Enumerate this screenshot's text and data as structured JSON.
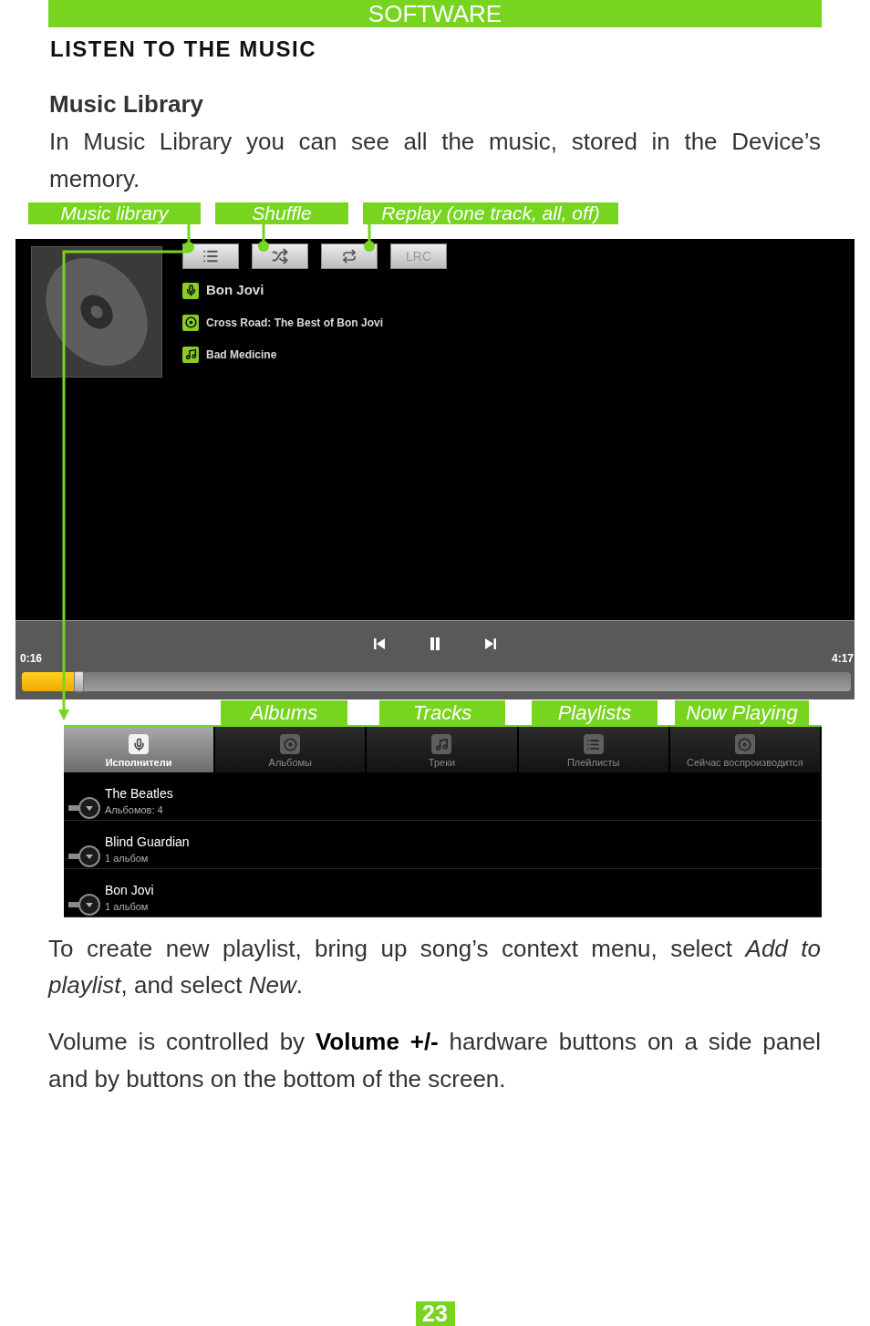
{
  "header": {
    "section": "SOFTWARE",
    "title": "LISTEN TO THE MUSIC"
  },
  "intro": {
    "heading": "Music Library",
    "text": "In Music Library you can see all the music, stored in the Device’s memory."
  },
  "figure": {
    "top_callouts": [
      "Music library",
      "Shuffle",
      "Replay (one track, all, off)"
    ],
    "player": {
      "lrc_button": "LRC",
      "track_info": [
        {
          "kind": "artist",
          "text": "Bon Jovi"
        },
        {
          "kind": "album",
          "text": "Cross Road: The Best of Bon Jovi"
        },
        {
          "kind": "track",
          "text": "Bad Medicine"
        }
      ],
      "elapsed": "0:16",
      "duration": "4:17",
      "progress": {
        "level": 0.067
      }
    },
    "bottom_callouts": [
      "Albums",
      "Tracks",
      "Playlists",
      "Now Playing"
    ],
    "tabs": [
      {
        "kind": "artists",
        "label": "Исполнители",
        "selected": true
      },
      {
        "kind": "albums",
        "label": "Альбомы",
        "selected": false
      },
      {
        "kind": "tracks",
        "label": "Треки",
        "selected": false
      },
      {
        "kind": "playlists",
        "label": "Плейлисты",
        "selected": false
      },
      {
        "kind": "playing",
        "label": "Сейчас воспроизводится",
        "selected": false
      }
    ],
    "artists": [
      {
        "name": "The Beatles",
        "detail": "Альбомов: 4"
      },
      {
        "name": "Blind Guardian",
        "detail": "1 альбом"
      },
      {
        "name": "Bon Jovi",
        "detail": "1 альбом"
      }
    ]
  },
  "paragraphs": [
    "To create new playlist, bring up song’s context menu, select *Add to playlist*, and select *New*.",
    "Volume is controlled by **Volume +/-** hardware buttons on a side panel and by buttons on the bottom of the screen."
  ],
  "page_number": "23"
}
